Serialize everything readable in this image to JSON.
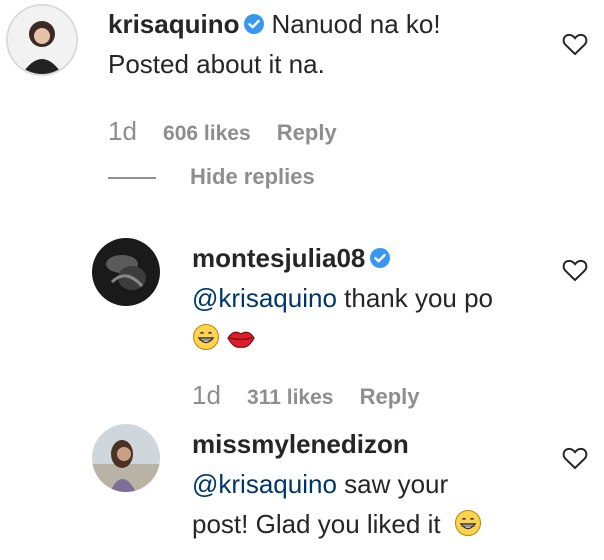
{
  "comments": [
    {
      "username": "krisaquino",
      "verified": true,
      "text_line1": "Nanuod na ko!",
      "text_line2": "Posted about it na.",
      "time": "1d",
      "likes": "606 likes",
      "reply": "Reply",
      "hide_replies": "Hide replies"
    },
    {
      "username": "montesjulia08",
      "verified": true,
      "mention": "@krisaquino",
      "text": " thank you po",
      "emojis": [
        "grinning-face",
        "kiss-lips"
      ],
      "time": "1d",
      "likes": "311 likes",
      "reply": "Reply"
    },
    {
      "username": "missmylenedizon",
      "verified": false,
      "mention": "@krisaquino",
      "text_line1": " saw your",
      "text_line2": "post! Glad you liked it",
      "emojis": [
        "grinning-face"
      ]
    }
  ],
  "colors": {
    "primary_text": "#262626",
    "secondary_text": "#8e8e8e",
    "mention": "#00376b",
    "verified_badge": "#3897f0"
  }
}
